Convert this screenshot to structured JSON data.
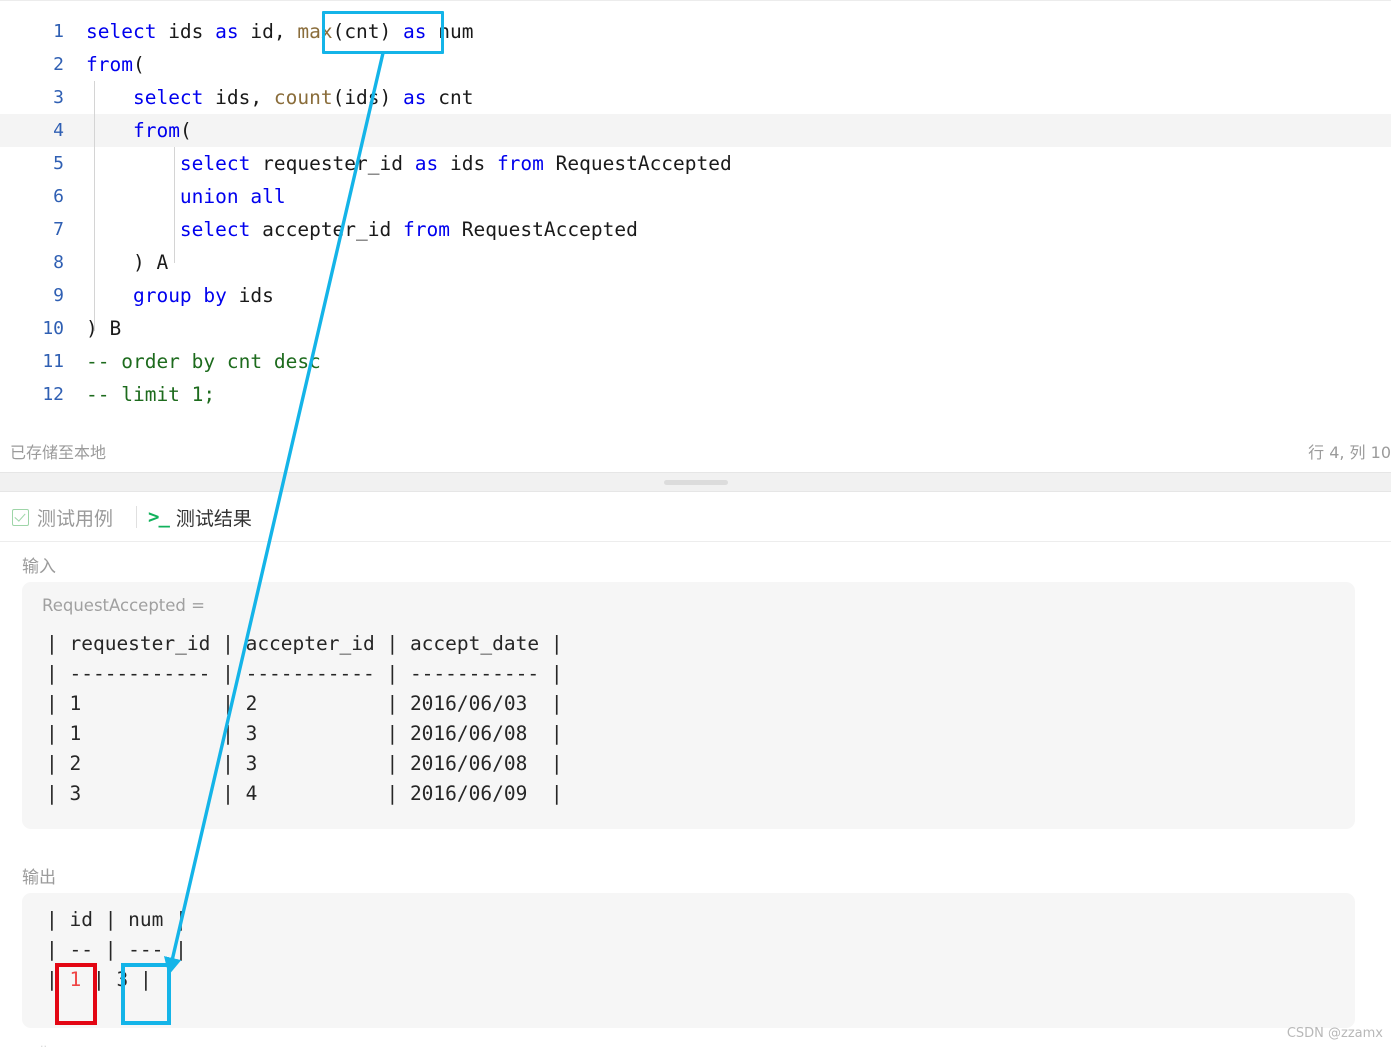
{
  "editor": {
    "language": "sql",
    "active_line": 4,
    "lines": [
      {
        "n": "1",
        "tokens": [
          {
            "t": "select",
            "c": "kw"
          },
          {
            "t": " ids ",
            "c": "id"
          },
          {
            "t": "as",
            "c": "kw"
          },
          {
            "t": " id, ",
            "c": "id"
          },
          {
            "t": "max",
            "c": "fn"
          },
          {
            "t": "(cnt) ",
            "c": "id"
          },
          {
            "t": "as",
            "c": "kw"
          },
          {
            "t": " num",
            "c": "id"
          }
        ]
      },
      {
        "n": "2",
        "tokens": [
          {
            "t": "from",
            "c": "kw"
          },
          {
            "t": "(",
            "c": "id"
          }
        ]
      },
      {
        "n": "3",
        "tokens": [
          {
            "t": "    ",
            "c": "id"
          },
          {
            "t": "select",
            "c": "kw"
          },
          {
            "t": " ids, ",
            "c": "id"
          },
          {
            "t": "count",
            "c": "fn"
          },
          {
            "t": "(ids) ",
            "c": "id"
          },
          {
            "t": "as",
            "c": "kw"
          },
          {
            "t": " cnt",
            "c": "id"
          }
        ]
      },
      {
        "n": "4",
        "tokens": [
          {
            "t": "    ",
            "c": "id"
          },
          {
            "t": "from",
            "c": "kw"
          },
          {
            "t": "(",
            "c": "id"
          }
        ]
      },
      {
        "n": "5",
        "tokens": [
          {
            "t": "        ",
            "c": "id"
          },
          {
            "t": "select",
            "c": "kw"
          },
          {
            "t": " requester_id ",
            "c": "id"
          },
          {
            "t": "as",
            "c": "kw"
          },
          {
            "t": " ids ",
            "c": "id"
          },
          {
            "t": "from",
            "c": "kw"
          },
          {
            "t": " RequestAccepted",
            "c": "id"
          }
        ]
      },
      {
        "n": "6",
        "tokens": [
          {
            "t": "        ",
            "c": "id"
          },
          {
            "t": "union all",
            "c": "kw"
          }
        ]
      },
      {
        "n": "7",
        "tokens": [
          {
            "t": "        ",
            "c": "id"
          },
          {
            "t": "select",
            "c": "kw"
          },
          {
            "t": " accepter_id ",
            "c": "id"
          },
          {
            "t": "from",
            "c": "kw"
          },
          {
            "t": " RequestAccepted",
            "c": "id"
          }
        ]
      },
      {
        "n": "8",
        "tokens": [
          {
            "t": "    ) A",
            "c": "id"
          }
        ]
      },
      {
        "n": "9",
        "tokens": [
          {
            "t": "    ",
            "c": "id"
          },
          {
            "t": "group by",
            "c": "kw"
          },
          {
            "t": " ids",
            "c": "id"
          }
        ]
      },
      {
        "n": "10",
        "tokens": [
          {
            "t": ") B",
            "c": "id"
          }
        ]
      },
      {
        "n": "11",
        "tokens": [
          {
            "t": "-- order by cnt desc",
            "c": "cm"
          }
        ]
      },
      {
        "n": "12",
        "tokens": [
          {
            "t": "-- limit 1;",
            "c": "cm"
          }
        ]
      }
    ]
  },
  "statusbar": {
    "saved_text": "已存储至本地",
    "cursor_text": "行 4, 列 10"
  },
  "tabs": {
    "testcases_label": "测试用例",
    "testresult_label": "测试结果",
    "terminal_glyph": ">_"
  },
  "input_section": {
    "label": "输入",
    "table_name": "RequestAccepted =",
    "rows": [
      "| requester_id | accepter_id | accept_date |",
      "| ------------ | ----------- | ----------- |",
      "| 1            | 2           | 2016/06/03  |",
      "| 1            | 3           | 2016/06/08  |",
      "| 2            | 3           | 2016/06/08  |",
      "| 3            | 4           | 2016/06/09  |"
    ]
  },
  "output_section": {
    "label": "输出",
    "rows": [
      "| id | num |",
      "| -- | --- |"
    ],
    "result_row": {
      "prefix": "| ",
      "id_value": "1",
      "middle": " | ",
      "num_value": "3",
      "suffix": " |"
    }
  },
  "annotations": {
    "arrow_color": "#14b4e8",
    "highlight_box_color": "#14b4e8",
    "error_box_color": "#e30613"
  },
  "watermark": {
    "text": "CSDN @zzamx"
  }
}
